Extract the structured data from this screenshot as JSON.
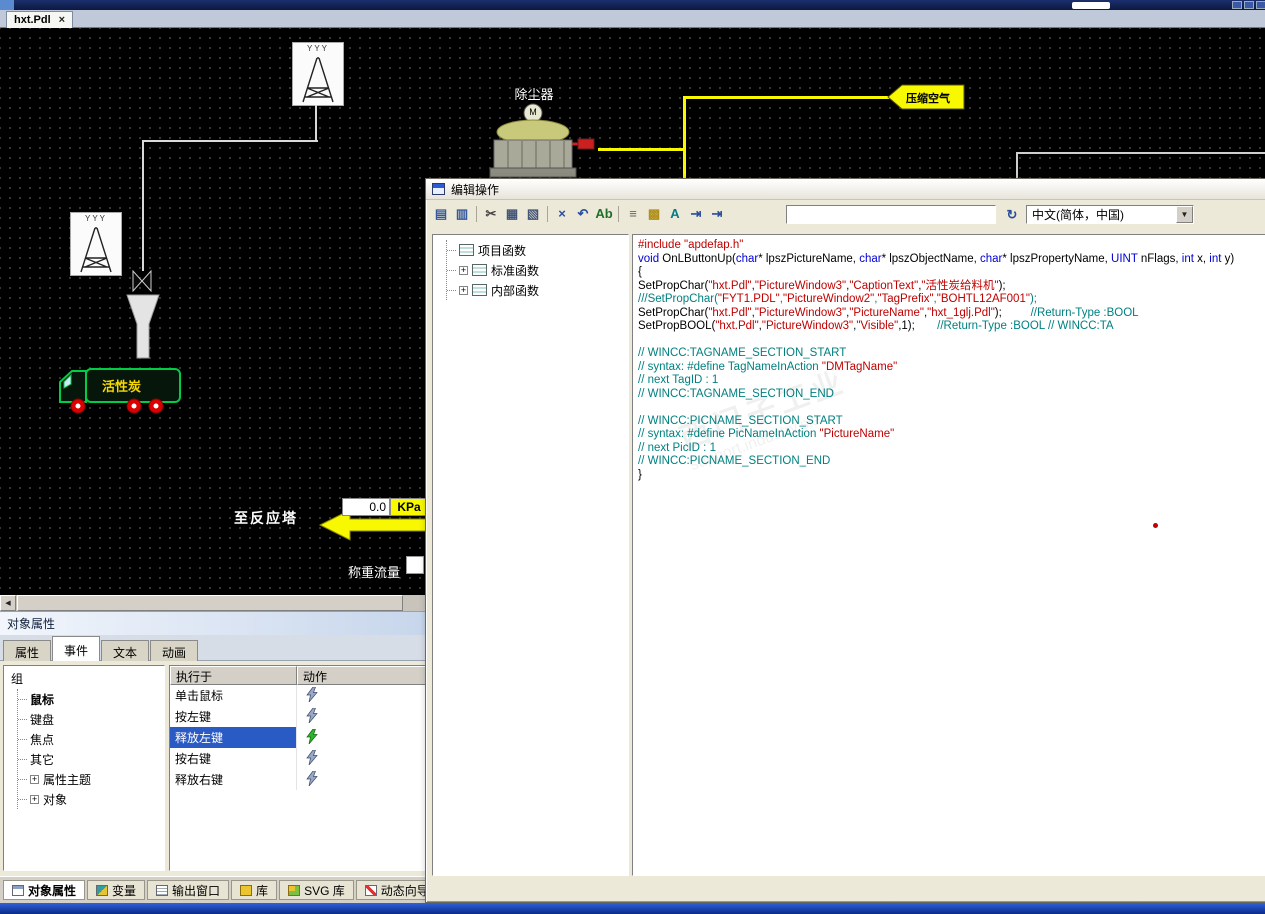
{
  "tab_bar": {
    "tab_label": "hxt.Pdl",
    "close_glyph": "×"
  },
  "scrollbar": {
    "left_arrow": "◀"
  },
  "canvas": {
    "tower_label": "YYY",
    "dust_collector": {
      "label": "除尘器",
      "motor_letter": "M"
    },
    "compressed_air_label": "压缩空气",
    "truck_label": "活性炭",
    "to_reaction_tower_label": "至反应塔",
    "pressure": {
      "value": "0.0",
      "unit": "KPa"
    },
    "weighing_flow_label": "称重流量",
    "watermark": {
      "line1": "西门子工业",
      "line2": "support.industry.sie…"
    }
  },
  "dialog": {
    "title": "编辑操作",
    "toolbar": {
      "icons": [
        {
          "name": "new-action-icon",
          "glyph": "▤",
          "color": "#35589c"
        },
        {
          "name": "compile-icon",
          "glyph": "▥",
          "color": "#35589c"
        },
        {
          "type": "sep"
        },
        {
          "name": "cut-icon",
          "glyph": "✂",
          "color": "#444444"
        },
        {
          "name": "copy-icon",
          "glyph": "▦",
          "color": "#445577"
        },
        {
          "name": "paste-icon",
          "glyph": "▧",
          "color": "#445577"
        },
        {
          "type": "sep"
        },
        {
          "name": "delete-icon",
          "glyph": "×",
          "color": "#2a4d9c"
        },
        {
          "name": "undo-icon",
          "glyph": "↶",
          "color": "#2a4d9c"
        },
        {
          "name": "spellcheck-icon",
          "glyph": "Ab",
          "color": "#20702a"
        },
        {
          "type": "sep"
        },
        {
          "name": "list-icon",
          "glyph": "≡",
          "color": "#666666"
        },
        {
          "name": "library-icon",
          "glyph": "▩",
          "color": "#b09018"
        },
        {
          "name": "font-icon",
          "glyph": "A",
          "color": "#067c84"
        },
        {
          "name": "goto-icon",
          "glyph": "⇥",
          "color": "#2a4d9c"
        },
        {
          "name": "export-icon",
          "glyph": "⇥",
          "color": "#2a4d9c"
        }
      ],
      "input_value": "",
      "refresh_glyph": "↻",
      "language_value": "中文(简体，中国)",
      "combo_arrow": "▼"
    },
    "tree": {
      "plus_glyph": "+",
      "items": [
        {
          "label": "项目函数",
          "expandable": false
        },
        {
          "label": "标准函数",
          "expandable": true
        },
        {
          "label": "内部函数",
          "expandable": true
        }
      ]
    },
    "code": {
      "colors": {
        "k": "#000000",
        "b": "#0000d4",
        "r": "#c00000",
        "c": "#008080"
      },
      "lines": [
        [
          [
            "r",
            "#include \"apdefap.h\""
          ]
        ],
        [
          [
            "b",
            "void"
          ],
          [
            "k",
            " OnLButtonUp("
          ],
          [
            "b",
            "char"
          ],
          [
            "k",
            "* lpszPictureName, "
          ],
          [
            "b",
            "char"
          ],
          [
            "k",
            "* lpszObjectName, "
          ],
          [
            "b",
            "char"
          ],
          [
            "k",
            "* lpszPropertyName, "
          ],
          [
            "b",
            "UINT"
          ],
          [
            "k",
            " nFlags, "
          ],
          [
            "b",
            "int"
          ],
          [
            "k",
            " x, "
          ],
          [
            "b",
            "int"
          ],
          [
            "k",
            " y)"
          ]
        ],
        [
          [
            "k",
            "{"
          ]
        ],
        [
          [
            "k",
            "SetPropChar("
          ],
          [
            "r",
            "\"hxt.Pdl\""
          ],
          [
            "k",
            ","
          ],
          [
            "r",
            "\"PictureWindow3\""
          ],
          [
            "k",
            ","
          ],
          [
            "r",
            "\"CaptionText\""
          ],
          [
            "k",
            ","
          ],
          [
            "r",
            "\"活性炭给料机\""
          ],
          [
            "k",
            ");"
          ]
        ],
        [
          [
            "c",
            "///SetPropChar("
          ],
          [
            "r",
            "\"FYT1.PDL\""
          ],
          [
            "c",
            ","
          ],
          [
            "r",
            "\"PictureWindow2\""
          ],
          [
            "c",
            ","
          ],
          [
            "r",
            "\"TagPrefix\""
          ],
          [
            "c",
            ","
          ],
          [
            "r",
            "\"BOHTL12AF001\""
          ],
          [
            "c",
            ");"
          ]
        ],
        [
          [
            "k",
            "SetPropChar("
          ],
          [
            "r",
            "\"hxt.Pdl\""
          ],
          [
            "k",
            ","
          ],
          [
            "r",
            "\"PictureWindow3\""
          ],
          [
            "k",
            ","
          ],
          [
            "r",
            "\"PictureName\""
          ],
          [
            "k",
            ","
          ],
          [
            "r",
            "\"hxt_1glj.Pdl\""
          ],
          [
            "k",
            ");         "
          ],
          [
            "c",
            "//Return-Type :BOOL"
          ]
        ],
        [
          [
            "k",
            "SetPropBOOL("
          ],
          [
            "r",
            "\"hxt.Pdl\""
          ],
          [
            "k",
            ","
          ],
          [
            "r",
            "\"PictureWindow3\""
          ],
          [
            "k",
            ","
          ],
          [
            "r",
            "\"Visible\""
          ],
          [
            "k",
            ",1);       "
          ],
          [
            "c",
            "//Return-Type :BOOL // WINCC:TA"
          ]
        ],
        [],
        [
          [
            "c",
            "// WINCC:TAGNAME_SECTION_START"
          ]
        ],
        [
          [
            "c",
            "// syntax: #define TagNameInAction "
          ],
          [
            "r",
            "\"DMTagName\""
          ]
        ],
        [
          [
            "c",
            "// next TagID : 1"
          ]
        ],
        [
          [
            "c",
            "// WINCC:TAGNAME_SECTION_END"
          ]
        ],
        [],
        [
          [
            "c",
            "// WINCC:PICNAME_SECTION_START"
          ]
        ],
        [
          [
            "c",
            "// syntax: #define PicNameInAction "
          ],
          [
            "r",
            "\"PictureName\""
          ]
        ],
        [
          [
            "c",
            "// next PicID : 1"
          ]
        ],
        [
          [
            "c",
            "// WINCC:PICNAME_SECTION_END"
          ]
        ],
        [
          [
            "k",
            "}"
          ]
        ]
      ]
    }
  },
  "properties": {
    "header": "对象属性",
    "tabs": [
      {
        "label": "属性"
      },
      {
        "label": "事件",
        "active": true
      },
      {
        "label": "文本"
      },
      {
        "label": "动画"
      }
    ],
    "tree": {
      "root": "组",
      "plus_glyph": "+",
      "children": [
        {
          "label": "鼠标",
          "selected": true
        },
        {
          "label": "键盘"
        },
        {
          "label": "焦点"
        },
        {
          "label": "其它"
        },
        {
          "label": "属性主题",
          "expandable": true
        },
        {
          "label": "对象",
          "expandable": true
        }
      ]
    },
    "table": {
      "headers": [
        "执行于",
        "动作"
      ],
      "rows": [
        {
          "label": "单击鼠标",
          "bolt": "gray"
        },
        {
          "label": "按左键",
          "bolt": "gray"
        },
        {
          "label": "释放左键",
          "bolt": "green",
          "selected": true
        },
        {
          "label": "按右键",
          "bolt": "gray"
        },
        {
          "label": "释放右键",
          "bolt": "gray"
        }
      ]
    }
  },
  "bottom_bar": {
    "tabs": [
      {
        "label": "对象属性",
        "icon": "props-icon",
        "active": true
      },
      {
        "label": "变量",
        "icon": "tag-icon"
      },
      {
        "label": "输出窗口",
        "icon": "output-icon"
      },
      {
        "label": "库",
        "icon": "library-icon"
      },
      {
        "label": "SVG 库",
        "icon": "svg-lib-icon"
      },
      {
        "label": "动态向导",
        "icon": "wizard-icon"
      }
    ]
  }
}
